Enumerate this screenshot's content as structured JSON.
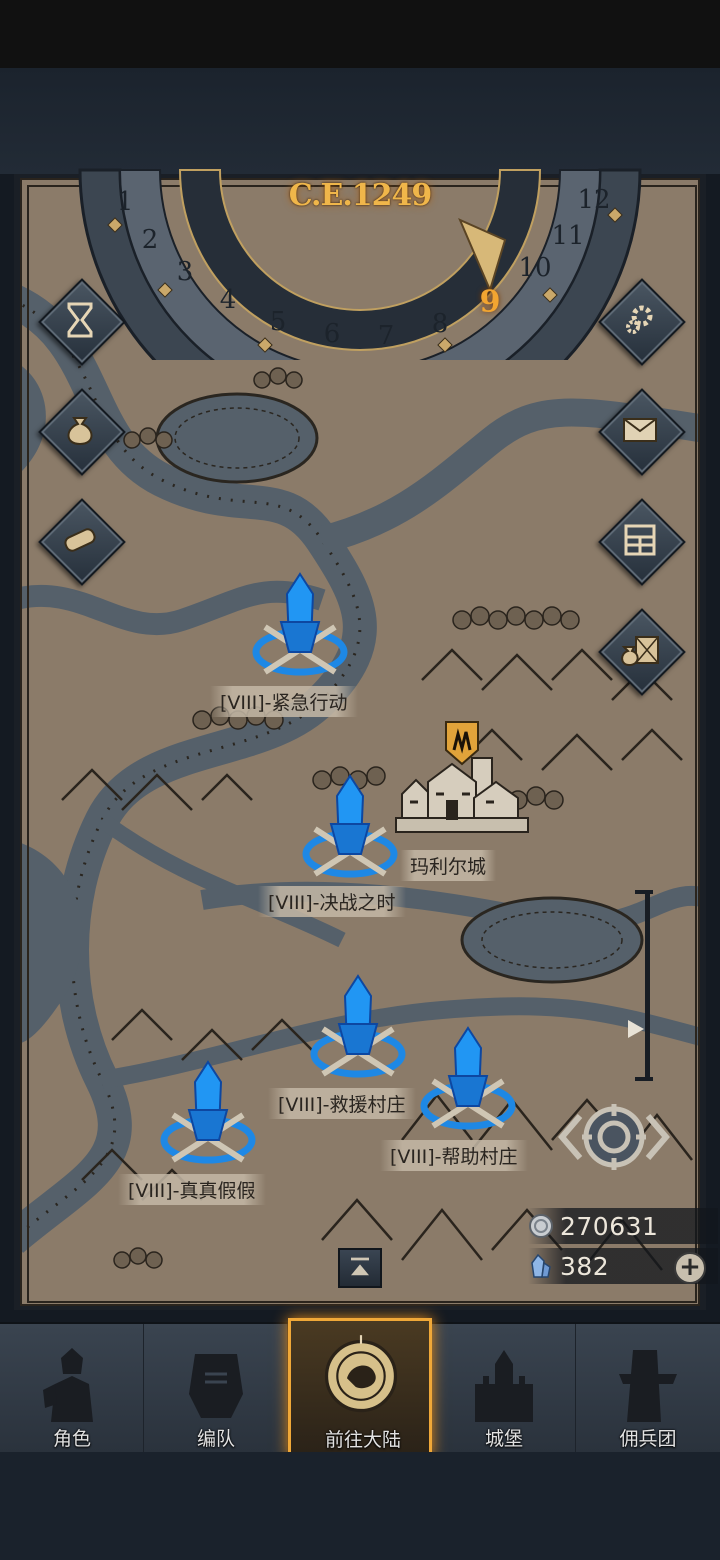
{
  "header": {
    "year": "C.E.1249",
    "months": [
      "1",
      "2",
      "3",
      "4",
      "5",
      "6",
      "7",
      "8",
      "9",
      "10",
      "11",
      "12"
    ],
    "current_month": "9"
  },
  "side_left": [
    {
      "name": "hourglass-icon"
    },
    {
      "name": "money-bag-icon"
    },
    {
      "name": "scroll-icon"
    }
  ],
  "side_right": [
    {
      "name": "gear-icon"
    },
    {
      "name": "mail-icon"
    },
    {
      "name": "board-icon"
    },
    {
      "name": "supplies-icon"
    }
  ],
  "locations": [
    {
      "label": "[VIII]-紧急行动"
    },
    {
      "label": "[VIII]-决战之时"
    },
    {
      "label": "[VIII]-救援村庄"
    },
    {
      "label": "[VIII]-帮助村庄"
    },
    {
      "label": "[VIII]-真真假假"
    }
  ],
  "city": {
    "label": "玛利尔城"
  },
  "resources": {
    "silver": "270631",
    "crystal": "382"
  },
  "tabs": [
    {
      "label": "角色",
      "icon": "knight-icon"
    },
    {
      "label": "编队",
      "icon": "helmet-icon"
    },
    {
      "label": "前往大陆",
      "icon": "compass-icon",
      "active": true
    },
    {
      "label": "城堡",
      "icon": "castle-icon"
    },
    {
      "label": "佣兵团",
      "icon": "mercenary-icon"
    }
  ],
  "colors": {
    "accent": "#f0a838",
    "marker": "#1e88e5",
    "parchment": "#8a7a68"
  }
}
